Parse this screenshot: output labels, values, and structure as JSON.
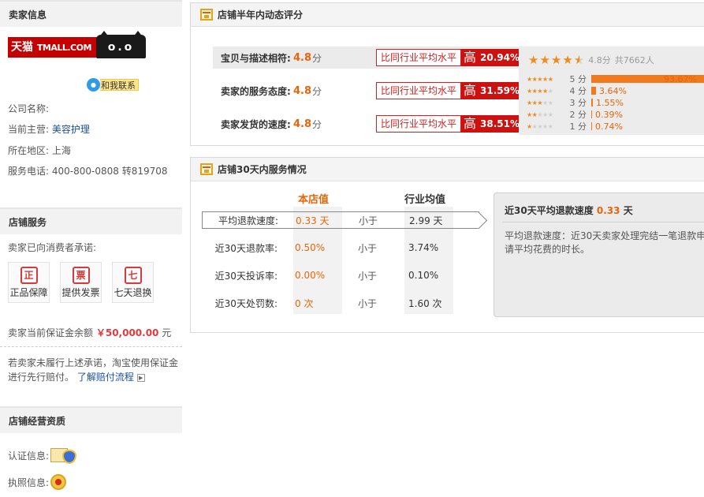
{
  "seller": {
    "heading": "卖家信息",
    "logo_text": "天猫",
    "logo_sub": "TMALL.COM",
    "logo_cat": "o.o",
    "contact_label": "和我联系",
    "company_label": "公司名称:",
    "company_value": "",
    "category_label": "当前主营:",
    "category_value": "美容护理",
    "region_label": "所在地区:",
    "region_value": "上海",
    "phone_label": "服务电话:",
    "phone_value": "400-800-0808 转819708"
  },
  "store_service": {
    "heading": "店铺服务",
    "promise_text": "卖家已向消费者承诺:",
    "badges": [
      {
        "glyph": "正",
        "label": "正品保障"
      },
      {
        "glyph": "票",
        "label": "提供发票"
      },
      {
        "glyph": "七",
        "label": "七天退换"
      }
    ],
    "deposit_prefix": "卖家当前保证金余额",
    "deposit_amount": "￥50,000.00",
    "deposit_unit": "元",
    "note_text": "若卖家未履行上述承诺，淘宝使用保证金进行先行赔付。",
    "note_link": "了解赔付流程"
  },
  "qualification": {
    "heading": "店铺经营资质",
    "cert_label": "认证信息:",
    "license_label": "执照信息:"
  },
  "dynamic_rating": {
    "title": "店铺半年内动态评分",
    "rows": [
      {
        "label": "宝贝与描述相符:",
        "value": "4.8",
        "unit": "分",
        "compare_label": "比同行业平均水平",
        "level": "高",
        "percent": "20.94%"
      },
      {
        "label": "卖家的服务态度:",
        "value": "4.8",
        "unit": "分",
        "compare_label": "比同行业平均水平",
        "level": "高",
        "percent": "31.59%"
      },
      {
        "label": "卖家发货的速度:",
        "value": "4.8",
        "unit": "分",
        "compare_label": "比同行业平均水平",
        "level": "高",
        "percent": "38.51%"
      }
    ],
    "summary": {
      "score": "4.8分",
      "count": "共7662人",
      "stars": 4.5
    },
    "distribution": [
      {
        "label": "5 分",
        "percent": "93.67%",
        "fraction": 0.9367,
        "stars": 5
      },
      {
        "label": "4 分",
        "percent": "3.64%",
        "fraction": 0.0364,
        "stars": 4
      },
      {
        "label": "3 分",
        "percent": "1.55%",
        "fraction": 0.0155,
        "stars": 3
      },
      {
        "label": "2 分",
        "percent": "0.39%",
        "fraction": 0.0039,
        "stars": 2
      },
      {
        "label": "1 分",
        "percent": "0.74%",
        "fraction": 0.0074,
        "stars": 1
      }
    ],
    "colors": {
      "accent": "#e8650a",
      "badge_red": "#cc1111",
      "star": "#f08a1d"
    }
  },
  "service_30d": {
    "title": "店铺30天内服务情况",
    "col_store": "本店值",
    "col_industry": "行业均值",
    "rows": [
      {
        "label": "平均退款速度:",
        "store": "0.33 天",
        "cmp": "小于",
        "industry": "2.99 天"
      },
      {
        "label": "近30天退款率:",
        "store": "0.50%",
        "cmp": "小于",
        "industry": "3.74%"
      },
      {
        "label": "近30天投诉率:",
        "store": "0.00%",
        "cmp": "小于",
        "industry": "0.10%"
      },
      {
        "label": "近30天处罚数:",
        "store": "0 次",
        "cmp": "小于",
        "industry": "1.60 次"
      }
    ],
    "tip": {
      "title_prefix": "近30天平均退款速度",
      "title_value": "0.33",
      "title_unit": "天",
      "text": "平均退款速度：近30天卖家处理完结一笔退款申请平均花费的时长。"
    }
  }
}
